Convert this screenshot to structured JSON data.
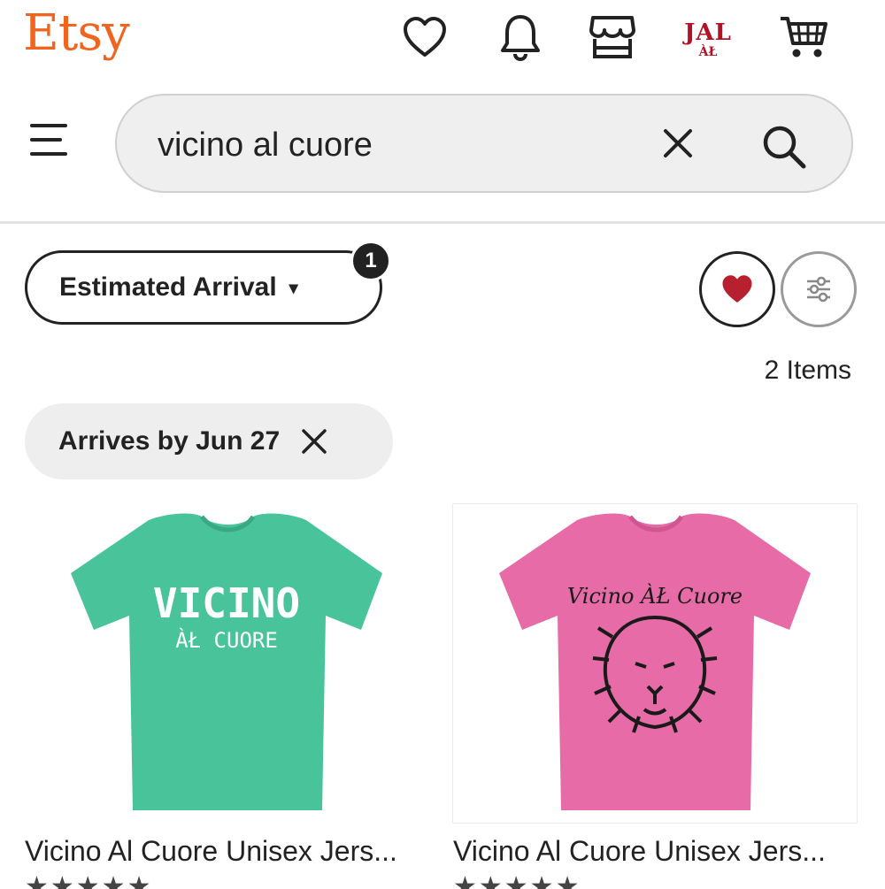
{
  "header": {
    "logo": "Etsy",
    "icons": [
      "heart-icon",
      "bell-icon",
      "shop-icon",
      "cart-icon"
    ],
    "avatar": {
      "line1": "JAL",
      "line2": "ÀŁ"
    }
  },
  "search": {
    "value": "vicino al cuore",
    "icons": [
      "menu-icon",
      "close-icon",
      "search-icon"
    ]
  },
  "filters": {
    "estimated_arrival_label": "Estimated Arrival",
    "badge_count": "1",
    "caret": "▾",
    "item_count": "2 Items",
    "applied_chip": "Arrives by Jun 27"
  },
  "colors": {
    "brand": "#F1641E",
    "favorite": "#B7212F",
    "teal_shirt": "#49C49A",
    "pink_shirt": "#E66BA6"
  },
  "listings": [
    {
      "title": "Vicino Al Cuore Unisex Jers...",
      "shirt_text_1": "VICINO",
      "shirt_text_2": "ÀŁ CUORE",
      "stars": "★★★★★"
    },
    {
      "title": "Vicino Al Cuore Unisex Jers...",
      "shirt_text_1": "Vicino ÀŁ Cuore",
      "stars": "★★★★★"
    }
  ]
}
